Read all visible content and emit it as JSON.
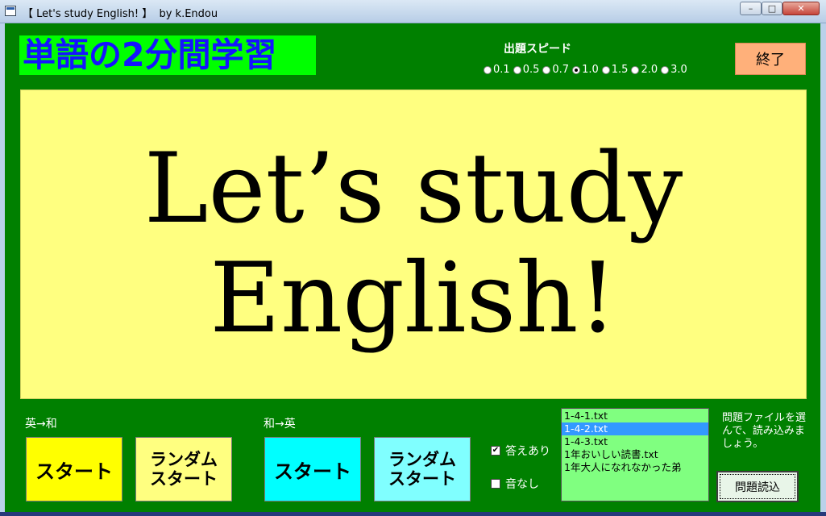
{
  "window": {
    "title": "【 Let's study English! 】  by k.Endou",
    "minimize": "–",
    "maximize": "□",
    "close": "✕"
  },
  "header": {
    "app_title": "単語の2分間学習",
    "speed_label": "出題スピード",
    "speed_options": [
      "0.1",
      "0.5",
      "0.7",
      "1.0",
      "1.5",
      "2.0",
      "3.0"
    ],
    "speed_selected": "1.0",
    "exit_label": "終了"
  },
  "display": {
    "line1": "Let’s study",
    "line2": "English!"
  },
  "en_to_ja": {
    "label": "英→和",
    "start_label": "スタート",
    "random_label_1": "ランダム",
    "random_label_2": "スタート"
  },
  "ja_to_en": {
    "label": "和→英",
    "start_label": "スタート",
    "random_label_1": "ランダム",
    "random_label_2": "スタート"
  },
  "options": {
    "show_answer_label": "答えあり",
    "show_answer_checked": true,
    "mute_label": "音なし",
    "mute_checked": false
  },
  "files": {
    "items": [
      "1-4-1.txt",
      "1-4-2.txt",
      "1-4-3.txt",
      "1年おいしい読書.txt",
      "1年大人になれなかった弟"
    ],
    "selected_index": 1,
    "hint": "問題ファイルを選んで、読み込みましょう。",
    "load_label": "問題読込"
  },
  "colors": {
    "background": "#008000",
    "title_bg": "#00ff00",
    "title_fg": "#1414ff",
    "display_bg": "#ffff80",
    "exit_bg": "#ffb07a",
    "en_start_bg": "#ffff00",
    "en_random_bg": "#ffff80",
    "ja_start_bg": "#00ffff",
    "ja_random_bg": "#80ffff",
    "filelist_bg": "#80ff80",
    "selected_bg": "#3399ff"
  }
}
